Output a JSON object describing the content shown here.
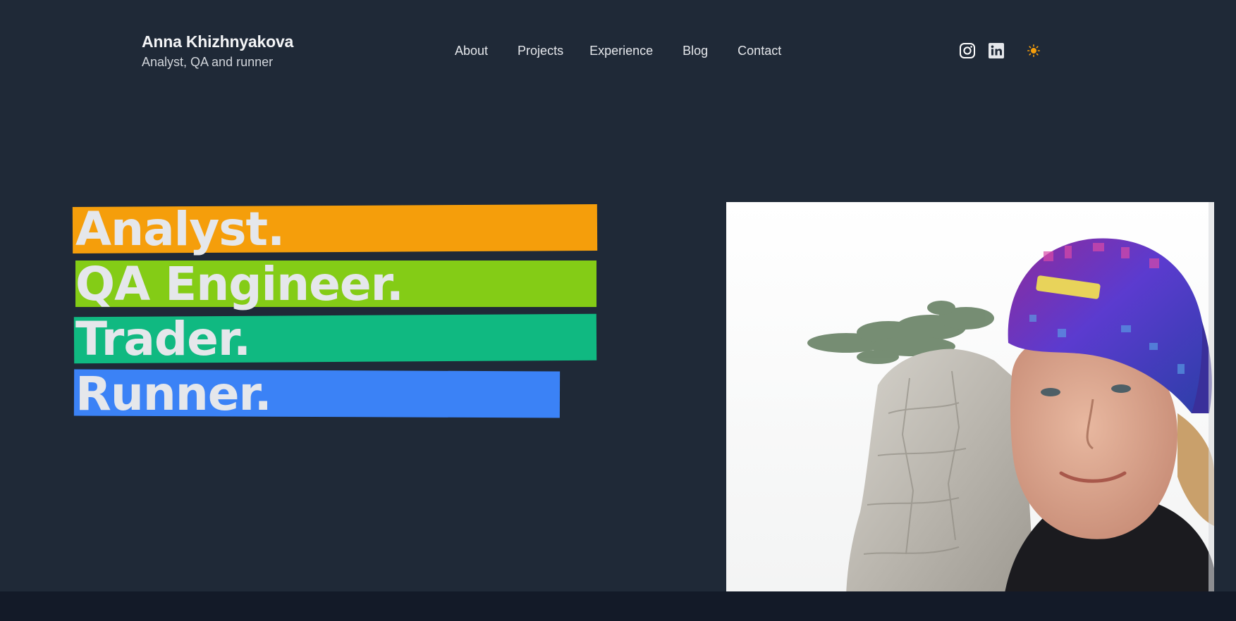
{
  "header": {
    "name": "Anna Khizhnyakova",
    "tagline": "Analyst, QA and runner"
  },
  "nav": {
    "items": [
      {
        "label": "About"
      },
      {
        "label": "Projects"
      },
      {
        "label": "Experience"
      },
      {
        "label": "Blog"
      },
      {
        "label": "Contact"
      }
    ]
  },
  "social": {
    "icons": [
      "instagram-icon",
      "linkedin-icon"
    ],
    "theme_toggle_icon": "sun-icon"
  },
  "hero": {
    "lines": [
      {
        "text": "Analyst.",
        "color": "#f59e0b"
      },
      {
        "text": "QA Engineer.",
        "color": "#84cc16"
      },
      {
        "text": "Trader.",
        "color": "#10b981"
      },
      {
        "text": "Runner.",
        "color": "#3b82f6"
      }
    ]
  },
  "colors": {
    "background": "#1f2937",
    "footer_band": "#131a28",
    "sun_accent": "#f59e0b"
  }
}
